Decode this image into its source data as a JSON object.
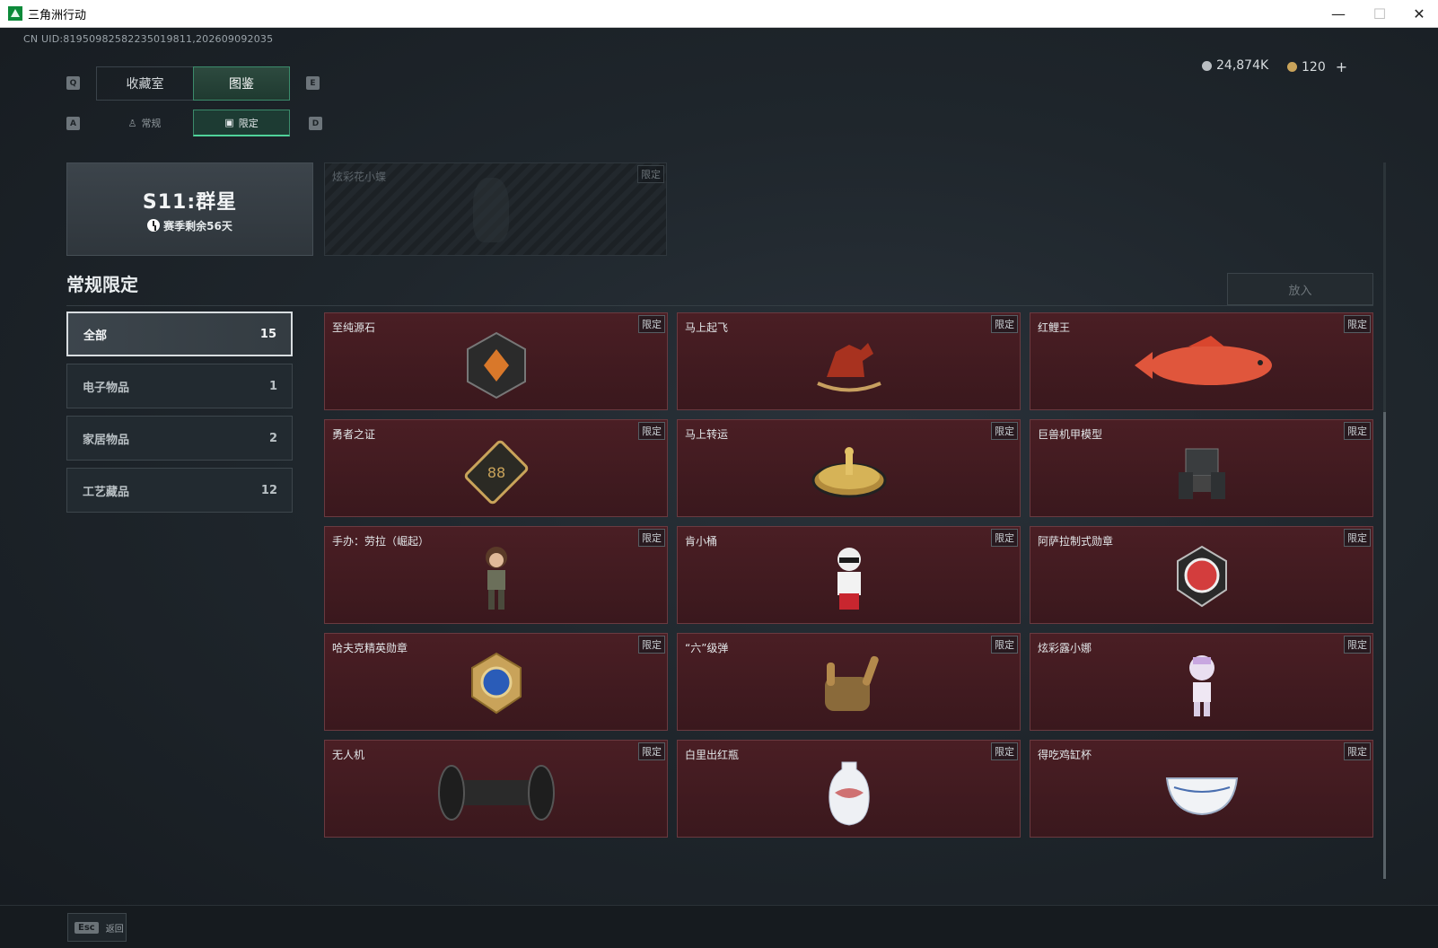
{
  "window": {
    "title": "三角洲行动"
  },
  "uid": "CN UID:81950982582235019811,202609092035",
  "keys": {
    "q": "Q",
    "e": "E",
    "a": "A",
    "d": "D"
  },
  "tabs": [
    {
      "label": "收藏室"
    },
    {
      "label": "图鉴"
    }
  ],
  "subtabs": [
    {
      "label": "常规"
    },
    {
      "label": "限定"
    }
  ],
  "currency": {
    "silver": "24,874K",
    "gold": "120",
    "add": "+"
  },
  "season": {
    "name": "S11:群星",
    "remaining": "赛季剩余56天"
  },
  "locked_item": {
    "name": "炫彩花小蝶",
    "badge": "限定"
  },
  "section": {
    "title": "常规限定",
    "put_button": "放入"
  },
  "categories": [
    {
      "label": "全部",
      "count": "15"
    },
    {
      "label": "电子物品",
      "count": "1"
    },
    {
      "label": "家居物品",
      "count": "2"
    },
    {
      "label": "工艺藏品",
      "count": "12"
    }
  ],
  "items": [
    {
      "name": "至纯源石",
      "badge": "限定"
    },
    {
      "name": "马上起飞",
      "badge": "限定"
    },
    {
      "name": "红鲤王",
      "badge": "限定"
    },
    {
      "name": "勇者之证",
      "badge": "限定"
    },
    {
      "name": "马上转运",
      "badge": "限定"
    },
    {
      "name": "巨兽机甲模型",
      "badge": "限定"
    },
    {
      "name": "手办：劳拉（崛起）",
      "badge": "限定"
    },
    {
      "name": "肯小桶",
      "badge": "限定"
    },
    {
      "name": "阿萨拉制式勋章",
      "badge": "限定"
    },
    {
      "name": "哈夫克精英勋章",
      "badge": "限定"
    },
    {
      "name": "“六”级弹",
      "badge": "限定"
    },
    {
      "name": "炫彩露小娜",
      "badge": "限定"
    },
    {
      "name": "无人机",
      "badge": "限定"
    },
    {
      "name": "白里出红瓶",
      "badge": "限定"
    },
    {
      "name": "得吃鸡缸杯",
      "badge": "限定"
    }
  ],
  "footer": {
    "esc_key": "Esc",
    "back_label": "返回"
  },
  "colors": {
    "accent": "#3b8b6b",
    "item_bg": "#4a1e24"
  }
}
